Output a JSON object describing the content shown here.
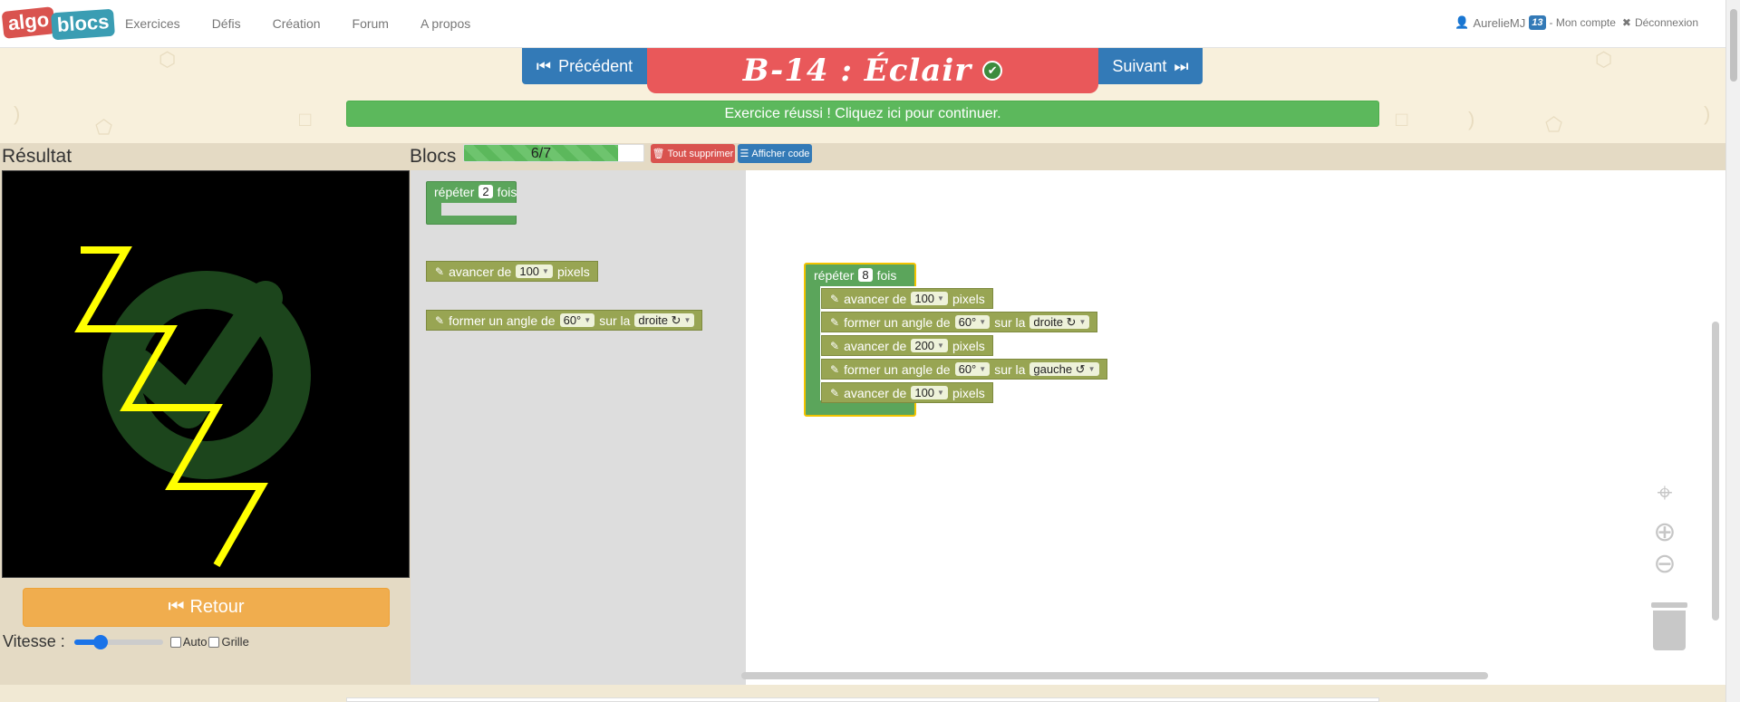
{
  "navbar": {
    "logo_part1": "algo",
    "logo_part2": "blocs",
    "links": [
      "Exercices",
      "Défis",
      "Création",
      "Forum",
      "A propos"
    ],
    "user_name": "AurelieMJ",
    "user_badge": "13",
    "account_label": "- Mon compte",
    "logout_label": "Déconnexion"
  },
  "exercise": {
    "prev_label": "Précédent",
    "next_label": "Suivant",
    "title": "B-14 : Éclair",
    "success_message": "Exercice réussi ! Cliquez ici pour continuer."
  },
  "result_panel": {
    "title": "Résultat",
    "retour_label": "Retour",
    "speed_label": "Vitesse :",
    "speed_fraction": 0.3,
    "auto_label": "Auto",
    "grid_label": "Grille",
    "auto_checked": false,
    "grid_checked": false
  },
  "blocks_panel": {
    "title": "Blocs",
    "progress_text": "6/7",
    "progress_fraction": 0.86,
    "delete_all_label": "Tout supprimer",
    "show_code_label": "Afficher code"
  },
  "toolbox": {
    "repeat": {
      "prefix": "répéter",
      "count": "2",
      "suffix": "fois"
    },
    "forward": {
      "prefix": "avancer de",
      "value": "100",
      "suffix": "pixels"
    },
    "turn": {
      "prefix": "former un angle de",
      "angle": "60°",
      "middle": "sur la",
      "direction": "droite ↻"
    }
  },
  "program": {
    "repeat": {
      "prefix": "répéter",
      "count": "8",
      "suffix": "fois"
    },
    "steps": [
      {
        "type": "forward",
        "prefix": "avancer de",
        "value": "100",
        "suffix": "pixels"
      },
      {
        "type": "turn",
        "prefix": "former un angle de",
        "angle": "60°",
        "middle": "sur la",
        "direction": "droite ↻"
      },
      {
        "type": "forward",
        "prefix": "avancer de",
        "value": "200",
        "suffix": "pixels"
      },
      {
        "type": "turn",
        "prefix": "former un angle de",
        "angle": "60°",
        "middle": "sur la",
        "direction": "gauche ↺"
      },
      {
        "type": "forward",
        "prefix": "avancer de",
        "value": "100",
        "suffix": "pixels"
      }
    ]
  },
  "colors": {
    "navbar_bg": "#ffffff",
    "title_bg": "#e9585a",
    "nav_button": "#337ab7",
    "success": "#5cb85c",
    "retour": "#f0ad4e",
    "block_olive": "#98a553",
    "block_green": "#5ba55b",
    "drawing_line": "#ffff00",
    "canvas_bg": "#000000"
  },
  "icons": {
    "prev": "step-backward-icon",
    "next": "step-forward-icon",
    "check": "check-circle-icon",
    "user": "user-icon",
    "logout": "close-icon",
    "trash": "trash-icon",
    "code": "list-icon",
    "retour": "fast-backward-icon",
    "recenter": "crosshair-icon",
    "zoom_in": "zoom-in-icon",
    "zoom_out": "zoom-out-icon",
    "pencil": "pencil-icon"
  }
}
